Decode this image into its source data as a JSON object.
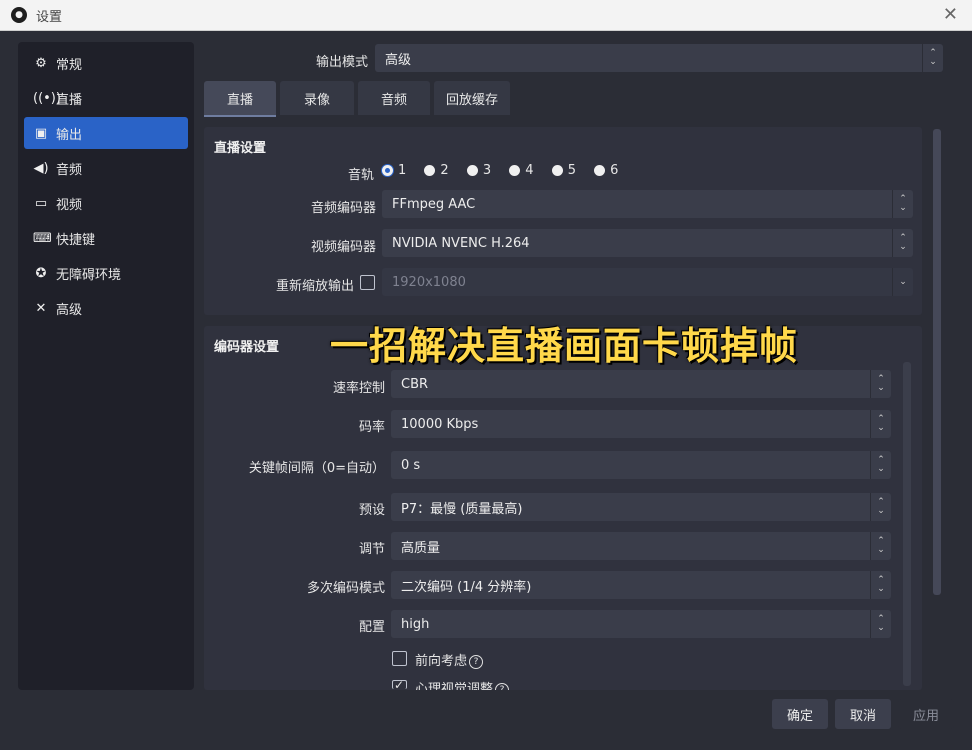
{
  "window": {
    "title": "设置",
    "close_icon": "close-icon"
  },
  "sidebar": {
    "items": [
      {
        "label": "常规",
        "icon": "gear-icon"
      },
      {
        "label": "直播",
        "icon": "broadcast-icon"
      },
      {
        "label": "输出",
        "icon": "output-icon",
        "active": true
      },
      {
        "label": "音频",
        "icon": "speaker-icon"
      },
      {
        "label": "视频",
        "icon": "monitor-icon"
      },
      {
        "label": "快捷键",
        "icon": "keyboard-icon"
      },
      {
        "label": "无障碍环境",
        "icon": "accessibility-icon"
      },
      {
        "label": "高级",
        "icon": "tools-icon"
      }
    ]
  },
  "output_mode": {
    "label": "输出模式",
    "value": "高级"
  },
  "tabs": [
    "直播",
    "录像",
    "音频",
    "回放缓存"
  ],
  "stream_settings": {
    "title": "直播设置",
    "audio_track": {
      "label": "音轨",
      "options": [
        "1",
        "2",
        "3",
        "4",
        "5",
        "6"
      ],
      "selected": "1"
    },
    "audio_encoder": {
      "label": "音频编码器",
      "value": "FFmpeg AAC"
    },
    "video_encoder": {
      "label": "视频编码器",
      "value": "NVIDIA NVENC H.264"
    },
    "rescale": {
      "label": "重新缩放输出",
      "value": "1920x1080",
      "checked": false
    }
  },
  "encoder_settings": {
    "title": "编码器设置",
    "rate_control": {
      "label": "速率控制",
      "value": "CBR"
    },
    "bitrate": {
      "label": "码率",
      "value": "10000 Kbps"
    },
    "keyframe": {
      "label": "关键帧间隔（0=自动）",
      "value": "0 s"
    },
    "preset": {
      "label": "预设",
      "value": "P7：最慢 (质量最高)"
    },
    "tuning": {
      "label": "调节",
      "value": "高质量"
    },
    "multipass": {
      "label": "多次编码模式",
      "value": "二次编码 (1/4 分辨率)"
    },
    "profile": {
      "label": "配置",
      "value": "high"
    },
    "lookahead": {
      "label": "前向考虑",
      "checked": false
    },
    "psycho": {
      "label": "心理视觉调整",
      "checked": true
    }
  },
  "overlay_caption": "一招解决直播画面卡顿掉帧",
  "buttons": {
    "ok": "确定",
    "cancel": "取消",
    "apply": "应用"
  },
  "colors": {
    "accent": "#2a63c7",
    "caption": "#ffd84a"
  }
}
